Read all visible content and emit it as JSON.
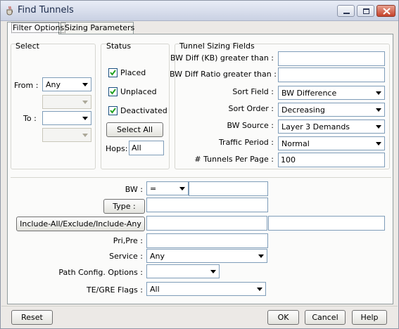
{
  "window": {
    "title": "Find Tunnels"
  },
  "tabs": [
    {
      "label": "Filter Options"
    },
    {
      "label": "Sizing Parameters"
    }
  ],
  "select": {
    "title": "Select",
    "from_label": "From :",
    "from_value": "Any",
    "to_label": "To :"
  },
  "status": {
    "title": "Status",
    "placed": {
      "label": "Placed",
      "checked": true
    },
    "unplaced": {
      "label": "Unplaced",
      "checked": true
    },
    "deactivated": {
      "label": "Deactivated",
      "checked": true
    },
    "select_all_label": "Select All",
    "hops_label": "Hops:",
    "hops_value": "All"
  },
  "sizing": {
    "title": "Tunnel Sizing Fields",
    "bw_diff_label": "BW Diff (KB) greater than :",
    "bw_diff_value": "",
    "bw_ratio_label": "BW Diff Ratio greater than :",
    "bw_ratio_value": "",
    "sort_field_label": "Sort Field :",
    "sort_field_value": "BW Difference",
    "sort_order_label": "Sort Order :",
    "sort_order_value": "Decreasing",
    "bw_source_label": "BW Source :",
    "bw_source_value": "Layer 3 Demands",
    "traffic_period_label": "Traffic Period :",
    "traffic_period_value": "Normal",
    "tunnels_per_page_label": "# Tunnels Per Page :",
    "tunnels_per_page_value": "100"
  },
  "filters": {
    "bw_label": "BW :",
    "bw_operator": "=",
    "bw_value": "",
    "type_button": "Type :",
    "include_button": "Include-All/Exclude/Include-Any",
    "pri_pre_label": "Pri,Pre :",
    "service_label": "Service :",
    "service_value": "Any",
    "path_config_label": "Path Config. Options :",
    "path_config_value": "",
    "te_gre_label": "TE/GRE Flags :",
    "te_gre_value": "All"
  },
  "footer": {
    "reset": "Reset",
    "ok": "OK",
    "cancel": "Cancel",
    "help": "Help"
  },
  "icons": {
    "app": "java-cup-icon",
    "minimize": "minimize-icon",
    "maximize": "maximize-icon",
    "close": "close-icon",
    "check": "checkmark-icon",
    "dropdown": "chevron-down-icon"
  }
}
